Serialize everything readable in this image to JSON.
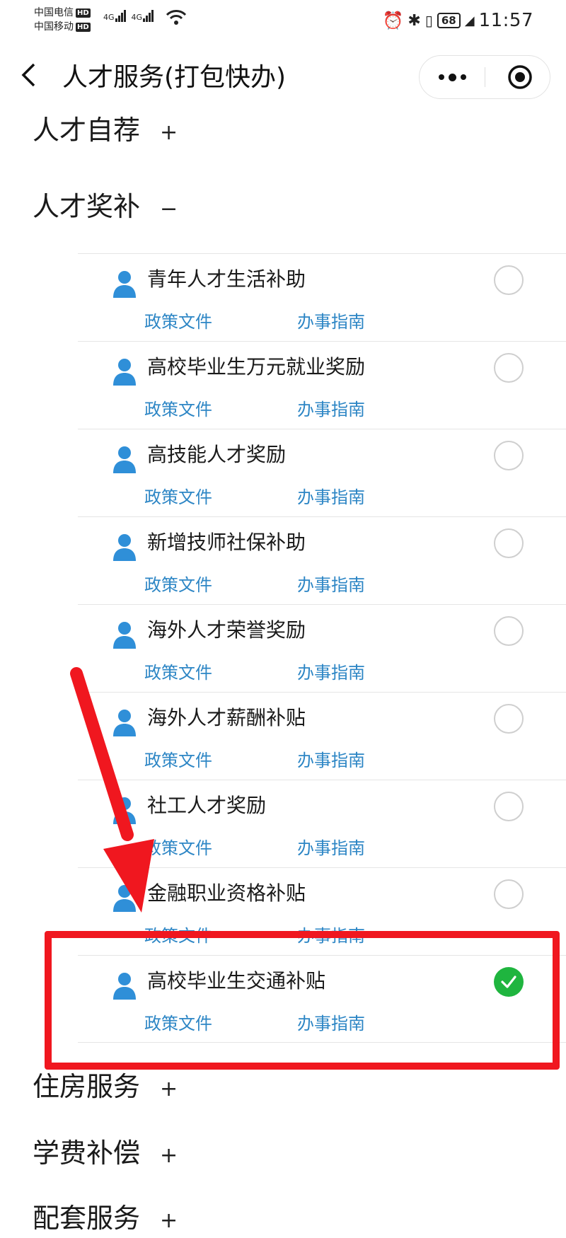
{
  "status_bar": {
    "carrier1": "中国电信",
    "carrier2": "中国移动",
    "hd": "HD",
    "net1": "4G",
    "net2": "4G",
    "battery": "68",
    "time": "11:57"
  },
  "navbar": {
    "back": "‹",
    "title": "人才服务(打包快办)"
  },
  "sections": {
    "self_recommend": {
      "label": "人才自荐",
      "toggle": "+"
    },
    "awards": {
      "label": "人才奖补",
      "toggle": "−"
    },
    "housing": {
      "label": "住房服务",
      "toggle": "+"
    },
    "tuition": {
      "label": "学费补偿",
      "toggle": "+"
    },
    "supporting": {
      "label": "配套服务",
      "toggle": "+"
    }
  },
  "links": {
    "policy": "政策文件",
    "guide": "办事指南"
  },
  "items": [
    {
      "name": "青年人才生活补助",
      "checked": false
    },
    {
      "name": "高校毕业生万元就业奖励",
      "checked": false
    },
    {
      "name": "高技能人才奖励",
      "checked": false
    },
    {
      "name": "新增技师社保补助",
      "checked": false
    },
    {
      "name": "海外人才荣誉奖励",
      "checked": false
    },
    {
      "name": "海外人才薪酬补贴",
      "checked": false
    },
    {
      "name": "社工人才奖励",
      "checked": false
    },
    {
      "name": "金融职业资格补贴",
      "checked": false
    },
    {
      "name": "高校毕业生交通补贴",
      "checked": true
    }
  ],
  "colors": {
    "link": "#2d86c5",
    "check": "#1fb53f",
    "annotation": "#f0171f",
    "person_icon": "#2f8fd8"
  }
}
